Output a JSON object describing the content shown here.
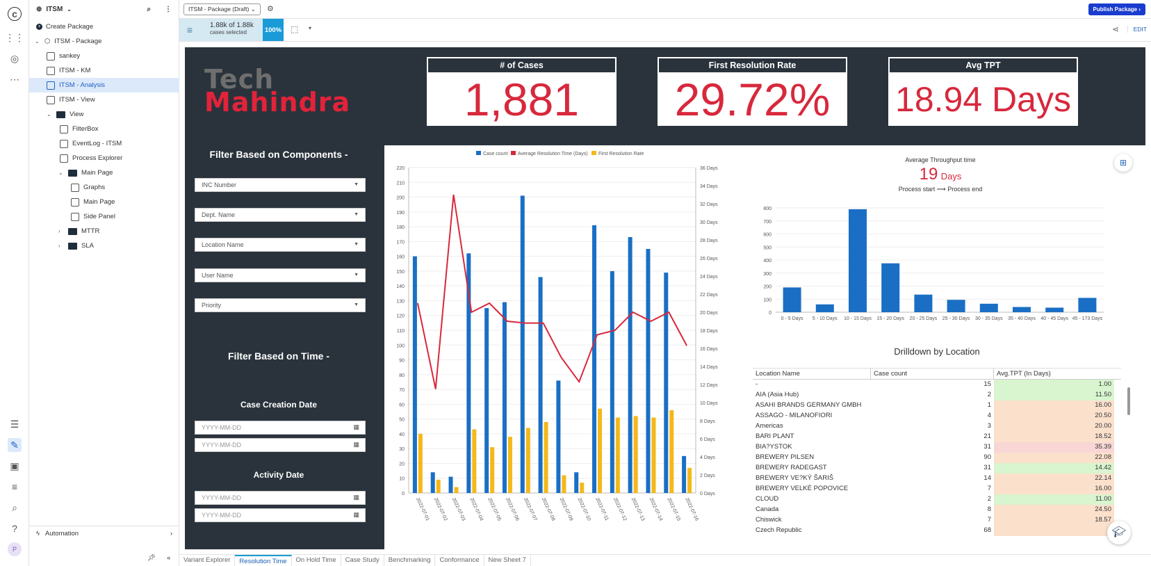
{
  "app": {
    "workspace": "ITSM",
    "package_select": "ITSM - Package (Draft)",
    "publish_label": "Publish Package"
  },
  "tree": {
    "create_label": "Create Package",
    "items": [
      {
        "label": "ITSM - Package"
      },
      {
        "label": "sankey"
      },
      {
        "label": "ITSM - KM"
      },
      {
        "label": "ITSM - Analysis"
      },
      {
        "label": "ITSM - View"
      },
      {
        "label": "View"
      },
      {
        "label": "FilterBox"
      },
      {
        "label": "EventLog - ITSM"
      },
      {
        "label": "Process Explorer"
      },
      {
        "label": "Main Page"
      },
      {
        "label": "Graphs"
      },
      {
        "label": "Main Page"
      },
      {
        "label": "Side Panel"
      },
      {
        "label": "MTTR"
      },
      {
        "label": "SLA"
      }
    ],
    "automation_label": "Automation",
    "avatar": "P"
  },
  "toolbar": {
    "cases_count": "1.88k of 1.88k",
    "cases_sub": "cases selected",
    "percent": "100%",
    "edit_label": "EDIT"
  },
  "kpis": [
    {
      "title": "# of Cases",
      "value": "1,881"
    },
    {
      "title": "First Resolution Rate",
      "value": "29.72%"
    },
    {
      "title": "Avg TPT",
      "value": "18.94 Days"
    }
  ],
  "logo": {
    "line1": "Tech",
    "line2": "Mahindra"
  },
  "filters": {
    "components_title": "Filter Based on Components -",
    "dropdowns": [
      "INC Number",
      "Dept. Name",
      "Location Name",
      "User Name",
      "Priority"
    ],
    "time_title": "Filter Based on Time -",
    "creation_title": "Case Creation Date",
    "activity_title": "Activity Date",
    "date_placeholder": "YYYY-MM-DD"
  },
  "chart_data": [
    {
      "type": "bar",
      "legend": [
        "Case count",
        "Average Resolution Time (Days)",
        "First Resolution Rate"
      ],
      "categories": [
        "2022-07-01",
        "2022-07-02",
        "2022-07-03",
        "2022-07-04",
        "2022-07-05",
        "2022-07-06",
        "2022-07-07",
        "2022-07-08",
        "2022-07-09",
        "2022-07-10",
        "2022-07-11",
        "2022-07-12",
        "2022-07-13",
        "2022-07-14",
        "2022-07-15",
        "2022-07-16"
      ],
      "series": [
        {
          "name": "Case count",
          "values": [
            160,
            14,
            11,
            162,
            125,
            129,
            201,
            146,
            76,
            14,
            181,
            150,
            173,
            165,
            149,
            25
          ]
        },
        {
          "name": "Average Resolution Time (Days)",
          "values": [
            21,
            11.5,
            33,
            20,
            21,
            19,
            18.8,
            18.8,
            15,
            12.3,
            17.5,
            18,
            20,
            19,
            20,
            16.3
          ]
        },
        {
          "name": "First Resolution Rate",
          "values": [
            40,
            9,
            4,
            43,
            31,
            38,
            44,
            48,
            12,
            7,
            57,
            51,
            52,
            51,
            56,
            17
          ]
        }
      ],
      "ylim": [
        0,
        220
      ],
      "y2lim": [
        0,
        36
      ],
      "yticks": [
        0,
        10,
        20,
        30,
        40,
        50,
        60,
        70,
        80,
        90,
        100,
        110,
        120,
        130,
        140,
        150,
        160,
        170,
        180,
        190,
        200,
        210,
        220
      ],
      "y2ticks": [
        "0 Days",
        "2 Days",
        "4 Days",
        "6 Days",
        "8 Days",
        "10 Days",
        "12 Days",
        "14 Days",
        "16 Days",
        "18 Days",
        "20 Days",
        "22 Days",
        "24 Days",
        "26 Days",
        "28 Days",
        "30 Days",
        "32 Days",
        "34 Days",
        "36 Days"
      ],
      "colors": {
        "bars": "#1a6fc4",
        "line": "#d8283c",
        "bars2": "#f5b81a"
      }
    },
    {
      "type": "bar",
      "title": "Average Throughput time",
      "categories": [
        "0 - 5 Days",
        "5 - 10 Days",
        "10 - 15 Days",
        "15 - 20 Days",
        "20 - 25 Days",
        "25 - 30 Days",
        "30 - 35 Days",
        "35 - 40 Days",
        "40 - 45 Days",
        "45 - 173 Days"
      ],
      "values": [
        190,
        60,
        790,
        375,
        135,
        95,
        65,
        40,
        35,
        110
      ],
      "ylim": [
        0,
        800
      ],
      "yticks": [
        0,
        100,
        200,
        300,
        400,
        500,
        600,
        700,
        800
      ]
    }
  ],
  "throughput": {
    "title": "Average Throughput time",
    "value": "19",
    "unit": "Days",
    "from": "Process start",
    "to": "Process end"
  },
  "drilldown": {
    "title": "Drilldown by Location",
    "headers": [
      "Location Name",
      "Case count",
      "Avg.TPT (In Days)"
    ],
    "rows": [
      [
        "-",
        "15",
        "1.00",
        "#d8f5d0"
      ],
      [
        "AIA (Asia Hub)",
        "2",
        "11.50",
        "#d8f5d0"
      ],
      [
        "ASAHI BRANDS GERMANY GMBH",
        "1",
        "16.00",
        "#fbe0cc"
      ],
      [
        "ASSAGO - MILANOFIORI",
        "4",
        "20.50",
        "#fbe0cc"
      ],
      [
        "Americas",
        "3",
        "20.00",
        "#fbe0cc"
      ],
      [
        "BARI PLANT",
        "21",
        "18.52",
        "#fbe0cc"
      ],
      [
        "BIA?YSTOK",
        "31",
        "35.39",
        "#f9d6d6"
      ],
      [
        "BREWERY PILSEN",
        "90",
        "22.08",
        "#fbe0cc"
      ],
      [
        "BREWERY RADEGAST",
        "31",
        "14.42",
        "#d8f5d0"
      ],
      [
        "BREWERY VE?KÝ ŠARIŠ",
        "14",
        "22.14",
        "#fbe0cc"
      ],
      [
        "BREWERY VELKÉ POPOVICE",
        "7",
        "16.00",
        "#fbe0cc"
      ],
      [
        "CLOUD",
        "2",
        "11.00",
        "#d8f5d0"
      ],
      [
        "Canada",
        "8",
        "24.50",
        "#fbe0cc"
      ],
      [
        "Chiswick",
        "7",
        "18.57",
        "#fbe0cc"
      ],
      [
        "Czech Republic",
        "68",
        "1",
        "#fbe0cc"
      ]
    ]
  },
  "sheet_tabs": [
    "Variant Explorer",
    "Resolution Time",
    "On Hold Time",
    "Case Study",
    "Benchmarking",
    "Conformance",
    "New Sheet 7"
  ],
  "active_tab": 1
}
